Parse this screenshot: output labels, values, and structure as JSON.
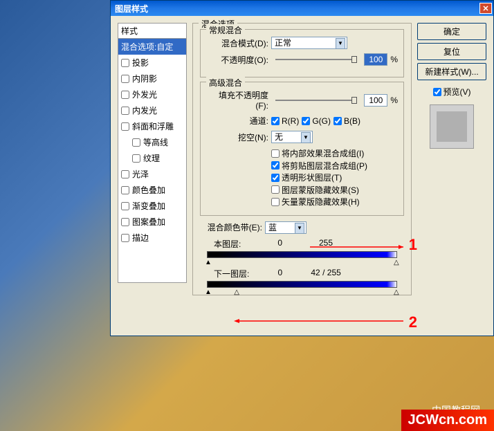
{
  "dialog_title": "图层样式",
  "styles_header": "样式",
  "styles": {
    "blending_custom": "混合选项:自定",
    "drop_shadow": "投影",
    "inner_shadow": "内阴影",
    "outer_glow": "外发光",
    "inner_glow": "内发光",
    "bevel_emboss": "斜面和浮雕",
    "contour": "等高线",
    "texture": "纹理",
    "satin": "光泽",
    "color_overlay": "颜色叠加",
    "gradient_overlay": "渐变叠加",
    "pattern_overlay": "图案叠加",
    "stroke": "描边"
  },
  "panel": {
    "title": "混合选项",
    "general": {
      "title": "常规混合",
      "mode_label": "混合模式(D):",
      "mode_value": "正常",
      "opacity_label": "不透明度(O):",
      "opacity_value": "100",
      "opacity_unit": "%"
    },
    "advanced": {
      "title": "高级混合",
      "fill_opacity_label": "填充不透明度(F):",
      "fill_opacity_value": "100",
      "fill_opacity_unit": "%",
      "channel_label": "通道:",
      "channel_r": "R(R)",
      "channel_g": "G(G)",
      "channel_b": "B(B)",
      "knockout_label": "挖空(N):",
      "knockout_value": "无",
      "interior_effects": "将内部效果混合成组(I)",
      "clipped_layers": "将剪贴图层混合成组(P)",
      "transparency_shapes": "透明形状图层(T)",
      "layer_mask_hide": "图层蒙版隐藏效果(S)",
      "vector_mask_hide": "矢量蒙版隐藏效果(H)"
    },
    "blend_if": {
      "label": "混合颜色带(E):",
      "channel": "蓝",
      "this_layer": "本图层:",
      "this_low": "0",
      "this_high": "255",
      "under_layer": "下一图层:",
      "under_low": "0",
      "under_mid": "42",
      "under_sep": "/",
      "under_high": "255"
    }
  },
  "buttons": {
    "ok": "确定",
    "reset": "复位",
    "new_style": "新建样式(W)...",
    "preview": "预览(V)"
  },
  "annotations": {
    "one": "1",
    "two": "2"
  },
  "watermark_text": "中国教程网",
  "watermark_logo": "JCWcn.com"
}
